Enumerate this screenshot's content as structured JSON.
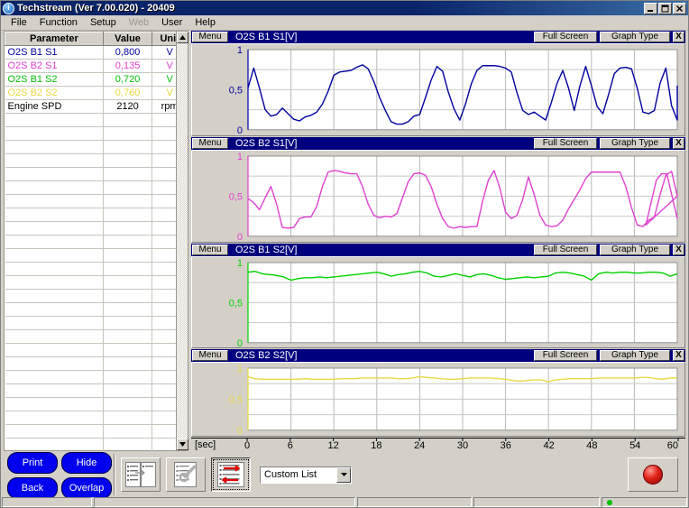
{
  "window": {
    "title": "Techstream (Ver 7.00.020) - 20409",
    "icon": "app-icon",
    "buttons": {
      "minimize": "minimize-icon",
      "maximize": "maximize-icon",
      "close": "close-icon"
    }
  },
  "menubar": {
    "items": [
      {
        "label": "File",
        "disabled": false
      },
      {
        "label": "Function",
        "disabled": false
      },
      {
        "label": "Setup",
        "disabled": false
      },
      {
        "label": "Web",
        "disabled": true
      },
      {
        "label": "User",
        "disabled": false
      },
      {
        "label": "Help",
        "disabled": false
      }
    ]
  },
  "parameters": {
    "headers": {
      "parameter": "Parameter",
      "value": "Value",
      "unit": "Unit"
    },
    "rows": [
      {
        "parameter": "O2S B1 S1",
        "value": "0,800",
        "unit": "V",
        "color": "#00009e"
      },
      {
        "parameter": "O2S B2 S1",
        "value": "0,135",
        "unit": "V",
        "color": "#e040d0"
      },
      {
        "parameter": "O2S B1 S2",
        "value": "0,720",
        "unit": "V",
        "color": "#00c000"
      },
      {
        "parameter": "O2S B2 S2",
        "value": "0,760",
        "unit": "V",
        "color": "#e8d840"
      },
      {
        "parameter": "Engine SPD",
        "value": "2120",
        "unit": "rpm",
        "color": "#000000"
      }
    ],
    "empty_row_count": 26
  },
  "graph_toolbar": {
    "menu_label": "Menu",
    "full_screen_label": "Full Screen",
    "graph_type_label": "Graph Type",
    "close_label": "X"
  },
  "xaxis": {
    "unit_label": "[sec]",
    "ticks": [
      "0",
      "6",
      "12",
      "18",
      "24",
      "30",
      "36",
      "42",
      "48",
      "54",
      "60"
    ]
  },
  "bottom_toolbar": {
    "buttons": [
      {
        "label": "Print",
        "name": "print-button"
      },
      {
        "label": "Hide",
        "name": "hide-button"
      },
      {
        "label": "Back",
        "name": "back-button"
      },
      {
        "label": "Overlap",
        "name": "overlap-button"
      }
    ],
    "icons": [
      {
        "name": "split-list-icon",
        "pressed": false
      },
      {
        "name": "list-settings-icon",
        "pressed": false
      },
      {
        "name": "list-transfer-icon",
        "pressed": true
      }
    ],
    "list_selector": {
      "value": "Custom List",
      "arrow": "chevron-down-icon"
    },
    "record_button": {
      "name": "record-button",
      "icon": "record-dot-icon"
    }
  },
  "status_bar": {
    "cells": [
      "",
      "",
      "",
      "",
      ""
    ]
  },
  "chart_data": [
    {
      "type": "line",
      "title": "O2S B1 S1[V]",
      "color": "#00009e",
      "xlabel": "[sec]",
      "ylabel": "V",
      "ylim": [
        0,
        1
      ],
      "yticks": [
        "1",
        "0,5",
        "0"
      ],
      "xlim": [
        0,
        60
      ],
      "grid": true,
      "series": [
        {
          "name": "O2S B1 S1",
          "x": [
            0,
            0.8,
            1.6,
            2.4,
            3.2,
            4,
            4.8,
            5.6,
            6.4,
            7.2,
            8,
            8.8,
            9.6,
            10.4,
            11.2,
            12,
            12.8,
            13.6,
            14.4,
            15.2,
            16,
            16.8,
            17.6,
            18.4,
            19.2,
            20,
            20.8,
            21.6,
            22.4,
            23.2,
            24,
            24.8,
            25.6,
            26.4,
            27.2,
            28,
            28.8,
            29.6,
            30.4,
            31.2,
            32,
            32.8,
            33.6,
            34.4,
            35.2,
            36,
            36.8,
            37.6,
            38.4,
            39.2,
            40,
            40.8,
            41.6,
            42.4,
            43.2,
            44,
            44.8,
            45.6,
            46.4,
            47.2,
            48,
            48.8,
            49.6,
            50.4,
            51.2,
            52,
            52.8,
            53.6,
            54.4,
            55.2,
            56,
            56.8,
            57.6,
            58.4,
            59.2,
            60
          ],
          "values": [
            0.52,
            0.77,
            0.52,
            0.25,
            0.17,
            0.19,
            0.27,
            0.2,
            0.13,
            0.11,
            0.16,
            0.18,
            0.22,
            0.32,
            0.48,
            0.68,
            0.72,
            0.73,
            0.74,
            0.78,
            0.81,
            0.76,
            0.6,
            0.4,
            0.24,
            0.1,
            0.07,
            0.07,
            0.1,
            0.17,
            0.19,
            0.4,
            0.62,
            0.79,
            0.73,
            0.47,
            0.26,
            0.12,
            0.32,
            0.57,
            0.74,
            0.8,
            0.8,
            0.8,
            0.79,
            0.77,
            0.72,
            0.46,
            0.24,
            0.19,
            0.22,
            0.17,
            0.12,
            0.34,
            0.58,
            0.74,
            0.52,
            0.24,
            0.55,
            0.79,
            0.55,
            0.29,
            0.2,
            0.44,
            0.7,
            0.77,
            0.78,
            0.76,
            0.52,
            0.22,
            0.2,
            0.24,
            0.58,
            0.77,
            0.3,
            0.12,
            0.55
          ]
        }
      ]
    },
    {
      "type": "line",
      "title": "O2S B2 S1[V]",
      "color": "#e040d0",
      "xlabel": "[sec]",
      "ylabel": "V",
      "ylim": [
        0,
        1
      ],
      "yticks": [
        "1",
        "0,5",
        "0"
      ],
      "xlim": [
        0,
        60
      ],
      "grid": true,
      "series": [
        {
          "name": "O2S B2 S1",
          "x": [
            0,
            0.8,
            1.6,
            2.4,
            3.2,
            4,
            4.8,
            5.6,
            6.4,
            7.2,
            8,
            8.8,
            9.6,
            10.4,
            11.2,
            12,
            12.8,
            13.6,
            14.4,
            15.2,
            16,
            16.8,
            17.6,
            18.4,
            19.2,
            20,
            20.8,
            21.6,
            22.4,
            23.2,
            24,
            24.8,
            25.6,
            26.4,
            27.2,
            28,
            28.8,
            29.6,
            30.4,
            31.2,
            32,
            32.8,
            33.6,
            34.4,
            35.2,
            36,
            36.8,
            37.6,
            38.4,
            39.2,
            40,
            40.8,
            41.6,
            42.4,
            43.2,
            44,
            44.8,
            45.6,
            46.4,
            47.2,
            48,
            48.8,
            49.6,
            50.4,
            51.2,
            52,
            52.8,
            53.6,
            54.4,
            55.2,
            56,
            56.8,
            57.6,
            58.4,
            59.2,
            60
          ],
          "values": [
            0.47,
            0.42,
            0.33,
            0.48,
            0.62,
            0.4,
            0.11,
            0.1,
            0.11,
            0.22,
            0.24,
            0.24,
            0.37,
            0.62,
            0.8,
            0.82,
            0.81,
            0.79,
            0.78,
            0.78,
            0.62,
            0.4,
            0.26,
            0.23,
            0.25,
            0.24,
            0.28,
            0.48,
            0.68,
            0.78,
            0.79,
            0.76,
            0.62,
            0.4,
            0.22,
            0.12,
            0.1,
            0.12,
            0.11,
            0.12,
            0.12,
            0.44,
            0.7,
            0.82,
            0.6,
            0.3,
            0.22,
            0.26,
            0.46,
            0.74,
            0.52,
            0.26,
            0.14,
            0.12,
            0.13,
            0.2,
            0.34,
            0.46,
            0.58,
            0.72,
            0.8,
            0.8,
            0.8,
            0.8,
            0.8,
            0.8,
            0.62,
            0.36,
            0.14,
            0.12,
            0.2,
            0.24,
            0.52,
            0.76,
            0.81,
            0.5,
            0.14,
            0.42,
            0.7,
            0.78,
            0.78,
            0.5,
            0.22
          ]
        }
      ]
    },
    {
      "type": "line",
      "title": "O2S B1 S2[V]",
      "color": "#00d000",
      "xlabel": "[sec]",
      "ylabel": "V",
      "ylim": [
        0,
        1
      ],
      "yticks": [
        "1",
        "0,5",
        "0"
      ],
      "grid": true,
      "xlim": [
        0,
        60
      ],
      "series": [
        {
          "name": "O2S B1 S2",
          "x": [
            0,
            1,
            2,
            3,
            4,
            5,
            6,
            7,
            8,
            9,
            10,
            11,
            12,
            13,
            14,
            15,
            16,
            17,
            18,
            19,
            20,
            21,
            22,
            23,
            24,
            25,
            26,
            27,
            28,
            29,
            30,
            31,
            32,
            33,
            34,
            35,
            36,
            37,
            38,
            39,
            40,
            41,
            42,
            43,
            44,
            45,
            46,
            47,
            48,
            49,
            50,
            51,
            52,
            53,
            54,
            55,
            56,
            57,
            58,
            59,
            60
          ],
          "values": [
            0.88,
            0.89,
            0.86,
            0.85,
            0.84,
            0.82,
            0.78,
            0.8,
            0.81,
            0.81,
            0.82,
            0.81,
            0.82,
            0.83,
            0.84,
            0.85,
            0.86,
            0.87,
            0.88,
            0.86,
            0.83,
            0.85,
            0.86,
            0.88,
            0.89,
            0.87,
            0.83,
            0.82,
            0.84,
            0.86,
            0.84,
            0.82,
            0.85,
            0.86,
            0.84,
            0.81,
            0.79,
            0.8,
            0.81,
            0.82,
            0.81,
            0.82,
            0.83,
            0.87,
            0.88,
            0.87,
            0.85,
            0.83,
            0.78,
            0.86,
            0.88,
            0.87,
            0.88,
            0.88,
            0.87,
            0.87,
            0.88,
            0.88,
            0.87,
            0.83,
            0.86
          ]
        }
      ]
    },
    {
      "type": "line",
      "title": "O2S B2 S2[V]",
      "color": "#e8d840",
      "xlabel": "[sec]",
      "ylabel": "V",
      "ylim": [
        0,
        1
      ],
      "yticks": [
        "1",
        "0,5",
        "0"
      ],
      "grid": true,
      "xlim": [
        0,
        60
      ],
      "series": [
        {
          "name": "O2S B2 S2",
          "x": [
            0,
            1,
            2,
            3,
            4,
            5,
            6,
            7,
            8,
            9,
            10,
            11,
            12,
            13,
            14,
            15,
            16,
            17,
            18,
            19,
            20,
            21,
            22,
            23,
            24,
            25,
            26,
            27,
            28,
            29,
            30,
            31,
            32,
            33,
            34,
            35,
            36,
            37,
            38,
            39,
            40,
            41,
            42,
            43,
            44,
            45,
            46,
            47,
            48,
            49,
            50,
            51,
            52,
            53,
            54,
            55,
            56,
            57,
            58,
            59,
            60
          ],
          "values": [
            0.86,
            0.83,
            0.82,
            0.82,
            0.82,
            0.82,
            0.82,
            0.82,
            0.83,
            0.82,
            0.82,
            0.82,
            0.82,
            0.83,
            0.83,
            0.83,
            0.84,
            0.84,
            0.84,
            0.84,
            0.84,
            0.83,
            0.83,
            0.84,
            0.86,
            0.85,
            0.84,
            0.83,
            0.82,
            0.82,
            0.83,
            0.84,
            0.84,
            0.84,
            0.84,
            0.83,
            0.82,
            0.8,
            0.79,
            0.8,
            0.81,
            0.81,
            0.78,
            0.81,
            0.82,
            0.83,
            0.83,
            0.83,
            0.83,
            0.84,
            0.84,
            0.84,
            0.84,
            0.84,
            0.84,
            0.85,
            0.85,
            0.83,
            0.82,
            0.84,
            0.84
          ]
        }
      ]
    }
  ]
}
